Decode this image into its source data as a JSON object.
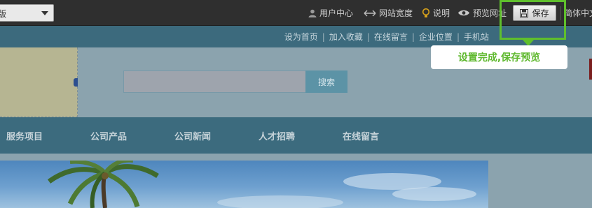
{
  "toolbar": {
    "template_select_value": "版",
    "user_center": "用户中心",
    "site_width": "网站宽度",
    "help": "说明",
    "preview_url": "预览网址",
    "save_label": "保存",
    "language": "简体中文"
  },
  "site_topbar": {
    "links": [
      "设为首页",
      "加入收藏",
      "在线留言",
      "企业位置",
      "手机站"
    ],
    "separator": "|"
  },
  "header": {
    "search_placeholder": "",
    "search_button": "搜索"
  },
  "nav": {
    "items": [
      "服务项目",
      "公司产品",
      "公司新闻",
      "人才招聘",
      "在线留言"
    ]
  },
  "guide": {
    "tooltip_text": "设置完成,保存预览",
    "highlight_color": "#5fbf2c"
  },
  "icons": [
    "chevron-down-icon",
    "user-icon",
    "resize-horizontal-icon",
    "lightbulb-icon",
    "eye-icon",
    "save-icon"
  ]
}
